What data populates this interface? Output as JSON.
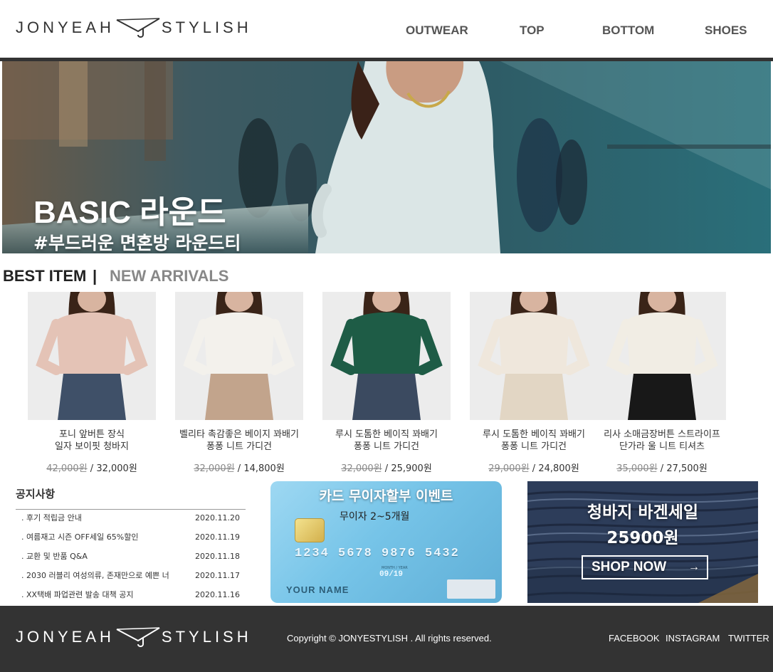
{
  "brand": {
    "left": "JONYEAH",
    "right": "STYLISH",
    "hanger_icon": "hanger-icon"
  },
  "nav": {
    "items": [
      "OUTWEAR",
      "TOP",
      "BOTTOM",
      "SHOES"
    ]
  },
  "hero": {
    "title": "BASIC 라운드",
    "tagline": "#부드러운 면혼방 라운드티"
  },
  "tabs": {
    "best": "BEST ITEM",
    "separator": "|",
    "new": "NEW ARRIVALS"
  },
  "products": [
    {
      "name1": "포니 앞버튼 장식",
      "name2": "일자 보이핏 청바지",
      "old_price": "42,000원",
      "sep": " / ",
      "price": "32,000원",
      "top_color": "#e4c3b6",
      "bottom_color": "#3f5068"
    },
    {
      "name1": "벨리타 촉감좋은 베이지 꽈배기",
      "name2": "퐁퐁 니트 가디건",
      "old_price": "32,000원",
      "sep": " / ",
      "price": "14,800원",
      "top_color": "#f3f1ec",
      "bottom_color": "#c2a48c"
    },
    {
      "name1": "루시 도톰한 베이직 꽈배기",
      "name2": "퐁퐁 니트 가디건",
      "old_price": "32,000원",
      "sep": " / ",
      "price": "25,900원",
      "top_color": "#1e5c46",
      "bottom_color": "#3b4a60"
    },
    {
      "name1": "루시 도톰한 베이직 꽈배기",
      "name2": "퐁퐁 니트 가디건",
      "old_price": "29,000원",
      "sep": " / ",
      "price": "24,800원",
      "top_color": "#efe7dc",
      "bottom_color": "#e2d6c4"
    },
    {
      "name1": "리사 소매금장버튼 스트라이프",
      "name2": "단가라 울 니트 티셔츠",
      "old_price": "35,000원",
      "sep": " / ",
      "price": "27,500원",
      "top_color": "#f1ede4",
      "bottom_color": "#181818"
    }
  ],
  "notice": {
    "title": "공지사항",
    "rows": [
      {
        "title": ". 후기 적립금 안내",
        "date": "2020.11.20"
      },
      {
        "title": ". 여름재고 시즌 OFF세일 65%할인",
        "date": "2020.11.19"
      },
      {
        "title": ". 교환 및 반품 Q&A",
        "date": "2020.11.18"
      },
      {
        "title": ". 2030 러블리 여성의류, 존재만으로 예쁜 너",
        "date": "2020.11.17"
      },
      {
        "title": ". XX택배 파업관련 발송 대책 공지",
        "date": "2020.11.16"
      }
    ]
  },
  "card_banner": {
    "title": "카드 무이자할부 이벤트",
    "subtitle": "무이자 2~5개월",
    "number": "1234 5678 9876 5432",
    "expiry_label": "MONTH / YEAR",
    "expiry": "09/19",
    "holder": "YOUR NAME"
  },
  "denim_banner": {
    "title": "청바지 바겐세일",
    "price": "25900원",
    "button": "SHOP NOW",
    "arrow": "→"
  },
  "footer": {
    "copyright": "Copyright © JONYESTYLISH . All rights reserved.",
    "links": [
      "FACEBOOK",
      "INSTAGRAM",
      "TWITTER"
    ]
  }
}
